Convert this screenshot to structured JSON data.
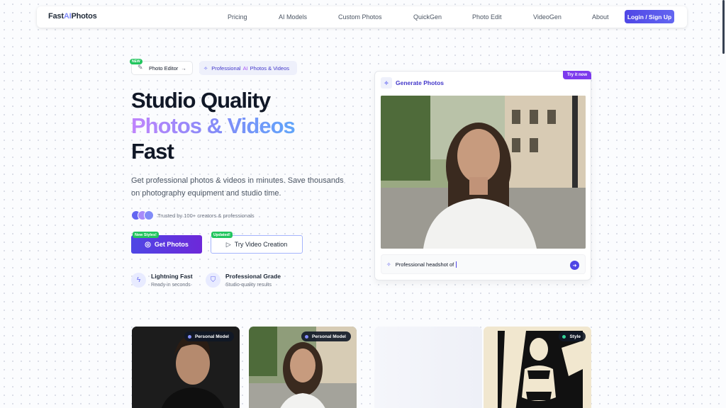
{
  "nav": {
    "logo_prefix": "Fast",
    "logo_ai": "AI",
    "logo_suffix": "Photos",
    "links": [
      "Pricing",
      "AI Models",
      "Custom Photos",
      "QuickGen",
      "Photo Edit",
      "VideoGen",
      "About"
    ],
    "login": "Login / Sign Up"
  },
  "hero": {
    "chip_new": "NEW",
    "chip_editor": "Photo Editor",
    "chip_editor_arrow": "→",
    "chip_pro_prefix": "Professional",
    "chip_pro_ai": "AI",
    "chip_pro_suffix": "Photos & Videos",
    "title_line1": "Studio Quality",
    "title_line2": "Photos & Videos",
    "title_line3": "Fast",
    "lead": "Get professional photos & videos in minutes. Save thousands on photography equipment and studio time.",
    "trust": "Trusted by 100+ creators & professionals",
    "trust_colors": [
      "#6366f1",
      "#a78bfa",
      "#818cf8"
    ],
    "tag_new_styles": "New Styles!",
    "btn_get_photos": "Get Photos",
    "tag_updated": "Updated!",
    "btn_try_video": "Try Video Creation",
    "features": [
      {
        "title": "Lightning Fast",
        "sub": "Ready in seconds",
        "icon": "lightning-icon"
      },
      {
        "title": "Professional Grade",
        "sub": "Studio-quality results",
        "icon": "shield-icon"
      }
    ]
  },
  "generator": {
    "badge": "Try it now",
    "heading": "Generate Photos",
    "prompt": "Professional headshot of"
  },
  "gallery": [
    {
      "label": "Personal Model",
      "dot_color": "#818cf8"
    },
    {
      "label": "Personal Model",
      "dot_color": "#818cf8"
    },
    {
      "label": "Style",
      "dot_color": "#34d399"
    }
  ],
  "colors": {
    "accent": "#4f46e5",
    "gradient_start": "#c084fc",
    "gradient_end": "#60a5fa",
    "badge_green": "#22c55e"
  }
}
